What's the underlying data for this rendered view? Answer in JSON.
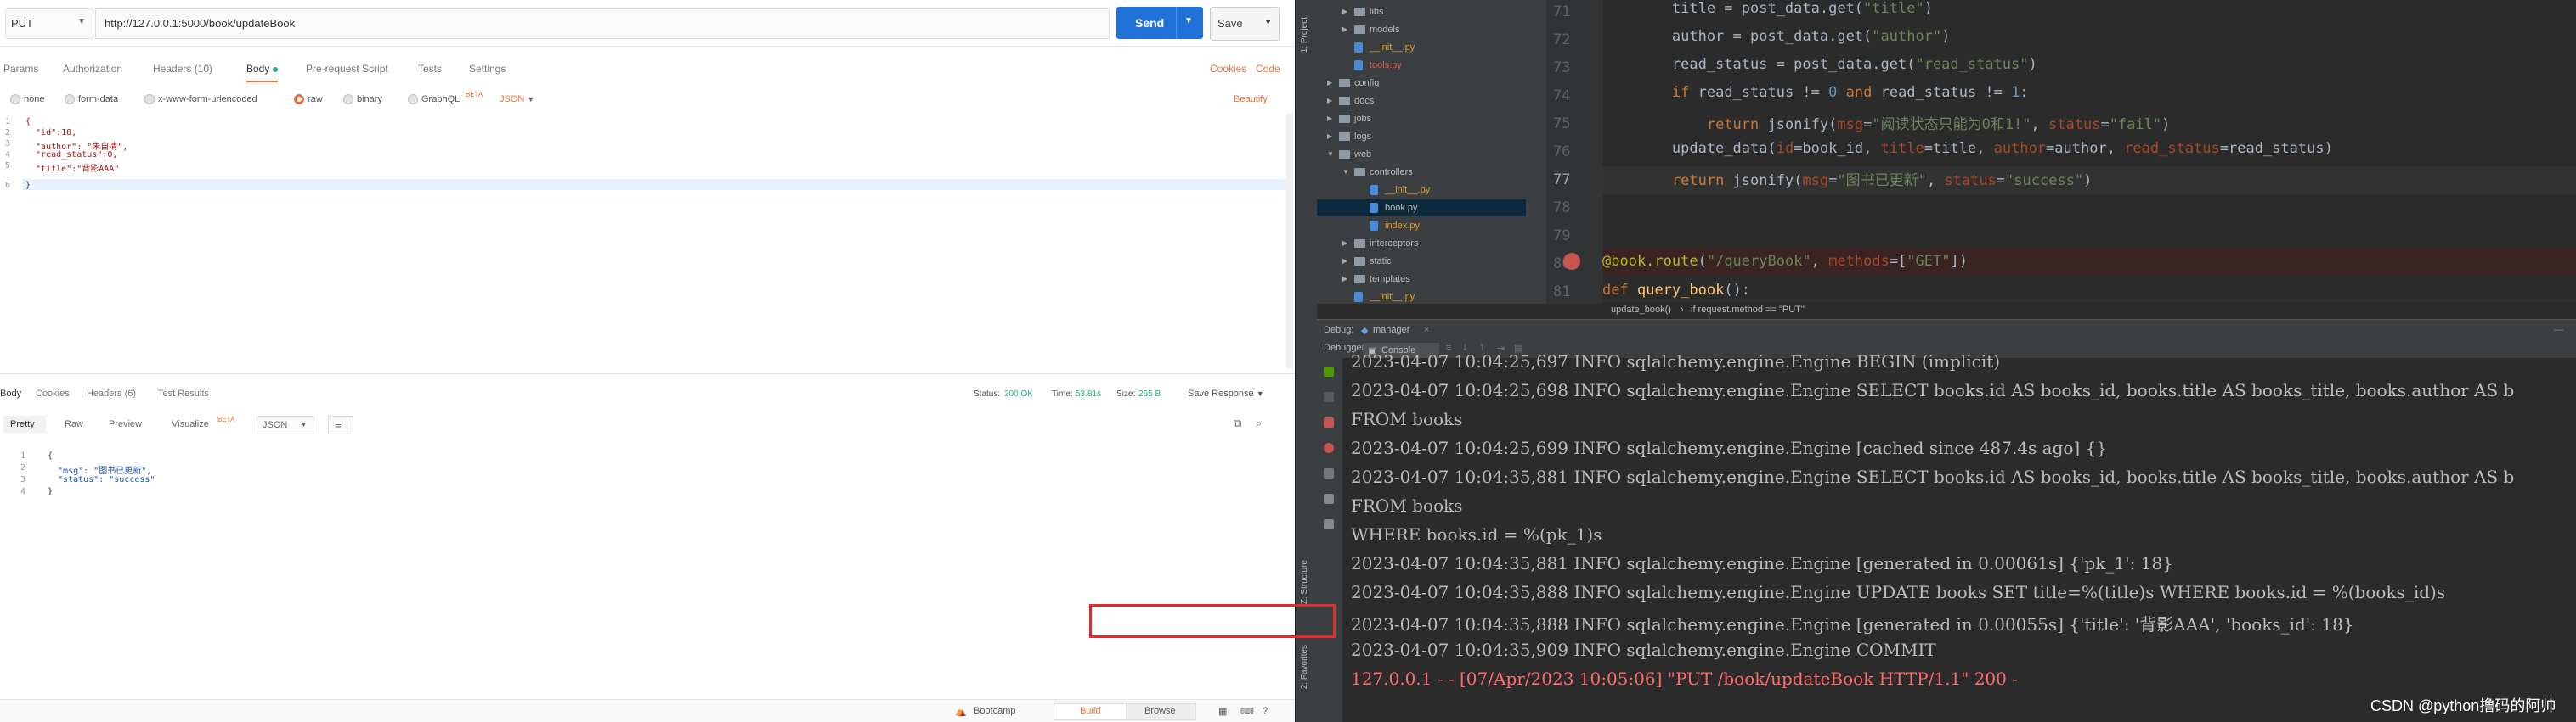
{
  "postman": {
    "method": "PUT",
    "url": "http://127.0.0.1:5000/book/updateBook",
    "send_label": "Send",
    "save_label": "Save",
    "request_tabs": [
      "Params",
      "Authorization",
      "Headers (10)",
      "Body",
      "Pre-request Script",
      "Tests",
      "Settings"
    ],
    "cookies_label": "Cookies",
    "code_label": "Code",
    "body_options": [
      "none",
      "form-data",
      "x-www-form-urlencoded",
      "raw",
      "binary",
      "GraphQL"
    ],
    "graphql_badge": "BETA",
    "body_format": "JSON",
    "beautify_label": "Beautify",
    "request_body": [
      {
        "n": "1",
        "text": "{"
      },
      {
        "n": "2",
        "text": "  \"id\":18,"
      },
      {
        "n": "3",
        "text": "  \"author\": \"朱自清\","
      },
      {
        "n": "4",
        "text": "  \"read_status\":0,"
      },
      {
        "n": "5",
        "text": "  \"title\":\"背影AAA\""
      },
      {
        "n": "6",
        "text": "}"
      }
    ],
    "response_tabs": [
      "Body",
      "Cookies",
      "Headers (6)",
      "Test Results"
    ],
    "status_label": "Status:",
    "status_value": "200 OK",
    "time_label": "Time:",
    "time_value": "53.81s",
    "size_label": "Size:",
    "size_value": "265 B",
    "save_response": "Save Response",
    "view_modes": [
      "Pretty",
      "Raw",
      "Preview",
      "Visualize"
    ],
    "visualize_badge": "BETA",
    "response_format": "JSON",
    "response_body": [
      {
        "n": "1",
        "text": "{"
      },
      {
        "n": "2",
        "text": "  \"msg\": \"图书已更新\","
      },
      {
        "n": "3",
        "text": "  \"status\": \"success\""
      },
      {
        "n": "4",
        "text": "}"
      }
    ],
    "status_bar": {
      "bootcamp": "Bootcamp",
      "build": "Build",
      "browse": "Browse"
    }
  },
  "pycharm": {
    "tree": [
      {
        "label": "libs",
        "kind": "folder",
        "depth": 2,
        "expanded": false
      },
      {
        "label": "models",
        "kind": "folder",
        "depth": 2,
        "expanded": false
      },
      {
        "label": "__init__.py",
        "kind": "py",
        "depth": 2,
        "style": "mod"
      },
      {
        "label": "tools.py",
        "kind": "py",
        "depth": 2,
        "style": "del"
      },
      {
        "label": "config",
        "kind": "folder",
        "depth": 1,
        "expanded": false
      },
      {
        "label": "docs",
        "kind": "folder",
        "depth": 1,
        "expanded": false
      },
      {
        "label": "jobs",
        "kind": "folder",
        "depth": 1,
        "expanded": false
      },
      {
        "label": "logs",
        "kind": "folder",
        "depth": 1,
        "expanded": false
      },
      {
        "label": "web",
        "kind": "folder",
        "depth": 1,
        "expanded": true
      },
      {
        "label": "controllers",
        "kind": "folder",
        "depth": 2,
        "expanded": true
      },
      {
        "label": "__init__.py",
        "kind": "py",
        "depth": 3,
        "style": "mod"
      },
      {
        "label": "book.py",
        "kind": "py",
        "depth": 3,
        "style": "normal",
        "selected": true
      },
      {
        "label": "index.py",
        "kind": "py",
        "depth": 3,
        "style": "mod"
      },
      {
        "label": "interceptors",
        "kind": "folder",
        "depth": 2,
        "expanded": false
      },
      {
        "label": "static",
        "kind": "folder",
        "depth": 2,
        "expanded": false
      },
      {
        "label": "templates",
        "kind": "folder",
        "depth": 2,
        "expanded": false
      },
      {
        "label": "__init__.py",
        "kind": "py",
        "depth": 2,
        "style": "mod"
      }
    ],
    "line_numbers": [
      "71",
      "72",
      "73",
      "74",
      "75",
      "76",
      "77",
      "78",
      "79",
      "80",
      "81"
    ],
    "breadcrumb": [
      "update_book()",
      "if request.method == \"PUT\""
    ],
    "debug_label": "Debug:",
    "run_config": "manager",
    "debugger_tab": "Debugger",
    "console_tab": "Console",
    "console_lines": [
      "2023-04-07 10:04:25,697 INFO sqlalchemy.engine.Engine BEGIN (implicit)",
      "2023-04-07 10:04:25,698 INFO sqlalchemy.engine.Engine SELECT books.id AS books_id, books.title AS books_title, books.author AS b",
      "FROM books",
      "2023-04-07 10:04:25,699 INFO sqlalchemy.engine.Engine [cached since 487.4s ago] {}",
      "2023-04-07 10:04:35,881 INFO sqlalchemy.engine.Engine SELECT books.id AS books_id, books.title AS books_title, books.author AS b",
      "FROM books",
      "WHERE books.id = %(pk_1)s",
      "2023-04-07 10:04:35,881 INFO sqlalchemy.engine.Engine [generated in 0.00061s] {'pk_1': 18}",
      "2023-04-07 10:04:35,888 INFO sqlalchemy.engine.Engine UPDATE books SET title=%(title)s WHERE books.id = %(books_id)s",
      "2023-04-07 10:04:35,888 INFO sqlalchemy.engine.Engine [generated in 0.00055s] {'title': '背影AAA', 'books_id': 18}",
      "2023-04-07 10:04:35,909 INFO sqlalchemy.engine.Engine COMMIT",
      "127.0.0.1 - - [07/Apr/2023 10:05:06] \"PUT /book/updateBook HTTP/1.1\" 200 -"
    ],
    "side_labels": {
      "project": "1: Project",
      "structure": "Z: Structure",
      "favorites": "2: Favorites"
    }
  },
  "watermark": "CSDN @python撸码的阿帅",
  "colors": {
    "send": "#1f73d8",
    "accent_orange": "#f26b3a",
    "status_green": "#26b47f",
    "highlight_box": "#e22a2a",
    "console_error": "#ff6b68"
  }
}
